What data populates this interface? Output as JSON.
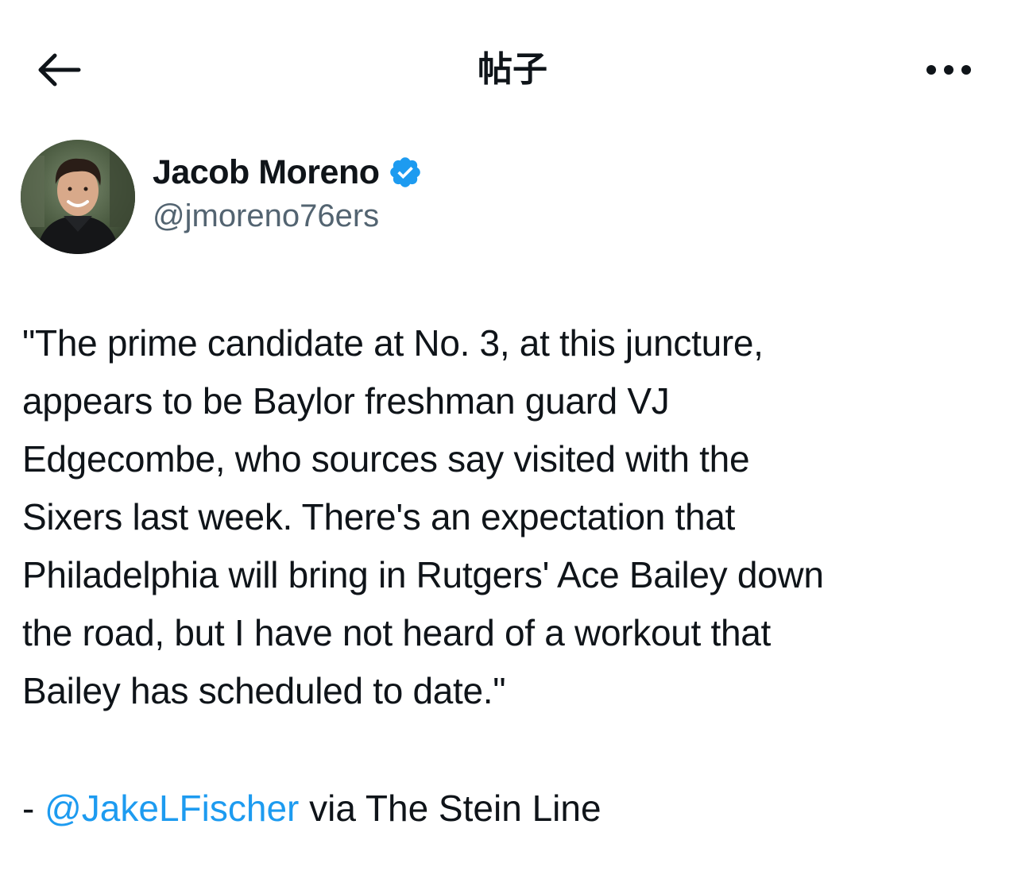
{
  "header": {
    "title": "帖子"
  },
  "author": {
    "name": "Jacob Moreno",
    "handle": "@jmoreno76ers",
    "verified": true
  },
  "tweet": {
    "lines": [
      "\"The prime candidate at No. 3, at this juncture,",
      "appears to be Baylor freshman guard VJ",
      "Edgecombe, who sources say visited with the",
      "Sixers last week. There's an expectation that",
      "Philadelphia will bring in Rutgers' Ace Bailey down",
      "the road, but I have not heard of a workout that",
      "Bailey has scheduled to date.\""
    ],
    "attribution_prefix": "- ",
    "attribution_mention": "@JakeLFischer",
    "attribution_suffix": " via The Stein Line"
  },
  "colors": {
    "accent": "#1d9bf0",
    "text": "#0f1419",
    "secondary": "#536471",
    "verified": "#1d9bf0"
  },
  "icons": {
    "back": "arrow-left-icon",
    "more": "more-horizontal-icon",
    "verified": "verified-badge-icon"
  }
}
